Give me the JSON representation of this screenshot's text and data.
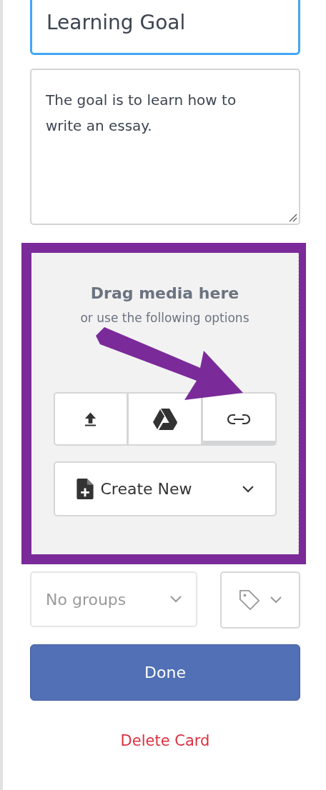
{
  "title_field": {
    "value": "Learning Goal",
    "focused": true
  },
  "description_field": {
    "value": "The goal is to learn how to write an essay."
  },
  "media_drop": {
    "highlighted": true,
    "heading": "Drag media here",
    "subheading": "or use the following options",
    "sources": [
      {
        "kind": "upload",
        "selected": false
      },
      {
        "kind": "drive",
        "selected": false
      },
      {
        "kind": "link",
        "selected": true
      }
    ],
    "create_button": {
      "label": "Create New"
    }
  },
  "groups_select": {
    "placeholder": "No groups"
  },
  "done_button": {
    "label": "Done"
  },
  "delete_link": {
    "label": "Delete Card"
  }
}
